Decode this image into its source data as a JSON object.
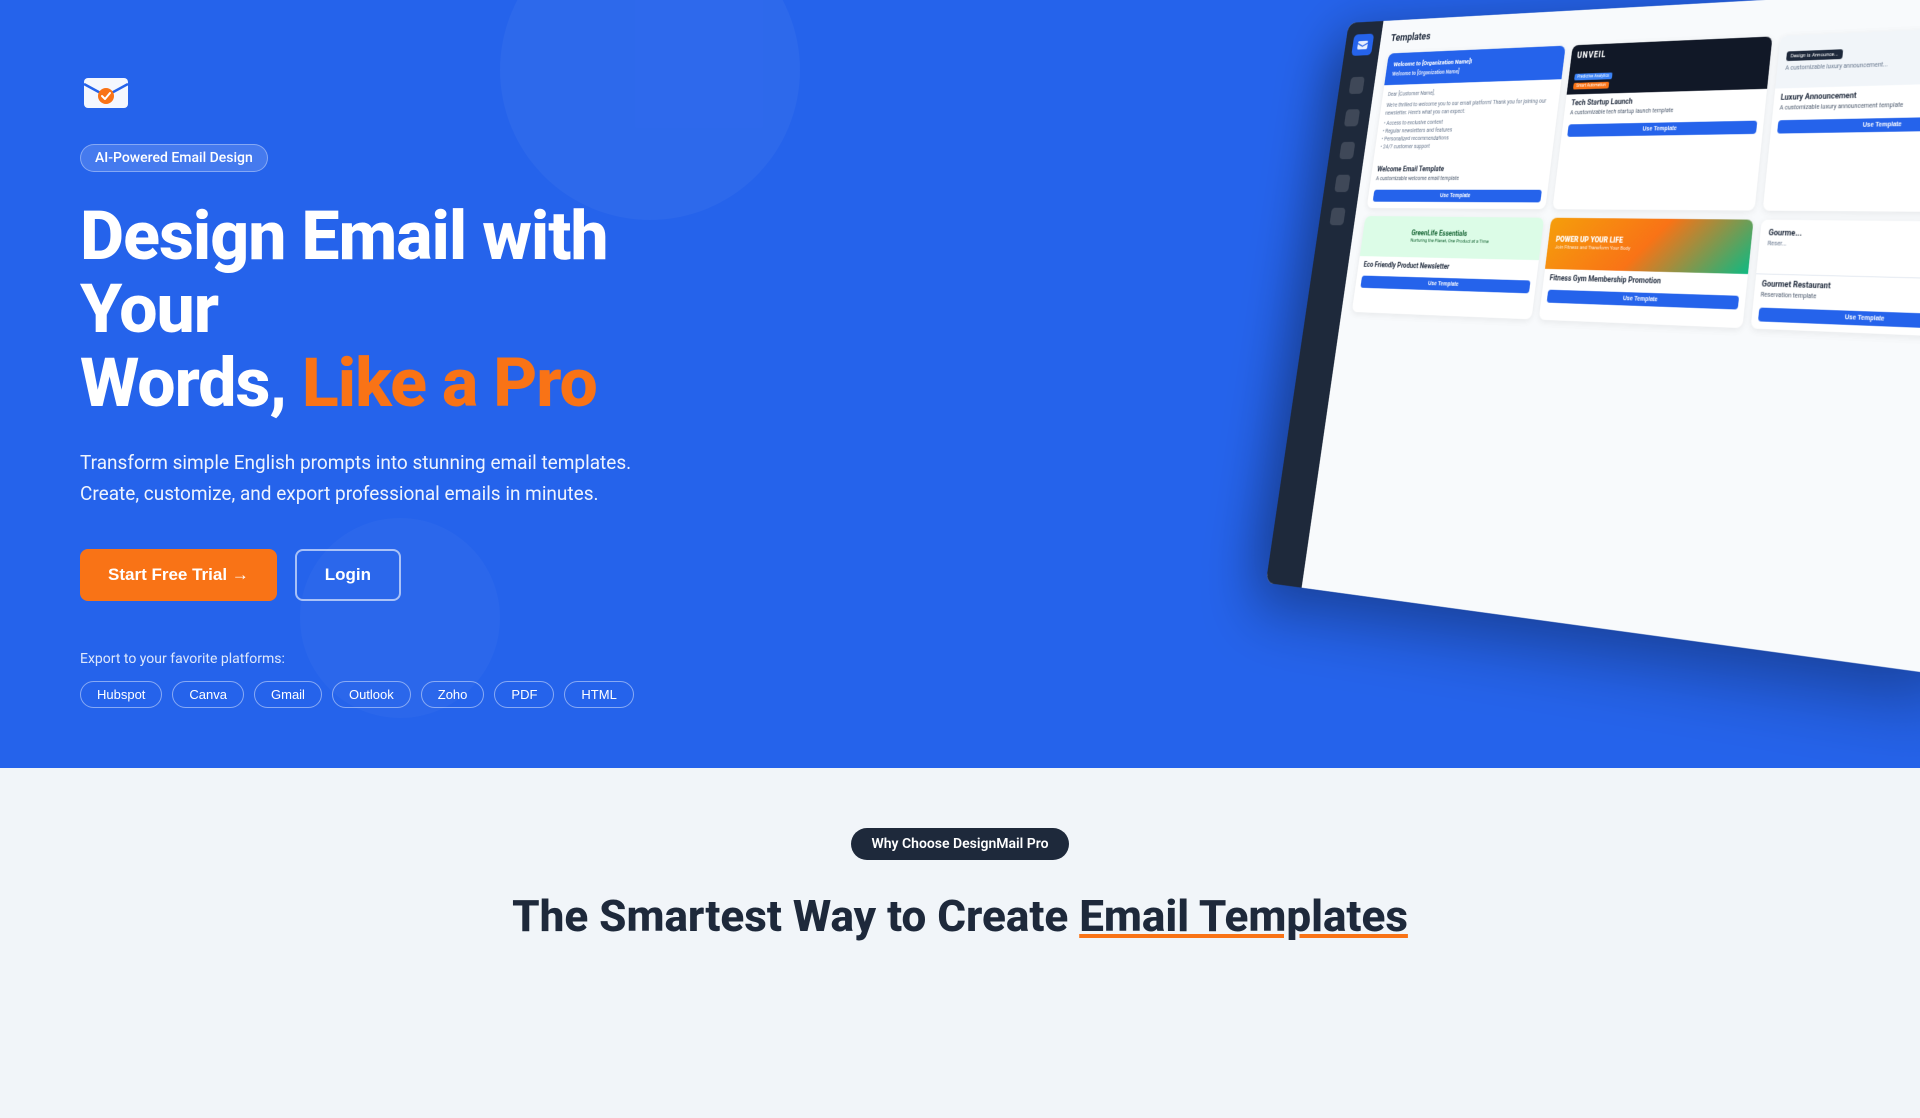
{
  "hero": {
    "badge": "AI-Powered Email Design",
    "headline_line1": "Design Email with Your",
    "headline_line2_plain": "Words, ",
    "headline_line2_highlight": "Like a Pro",
    "subtext": "Transform simple English prompts into stunning email templates. Create, customize, and export professional emails in minutes.",
    "cta_primary": "Start Free Trial →",
    "cta_secondary": "Login",
    "export_label": "Export to your favorite platforms:",
    "platforms": [
      "Hubspot",
      "Canva",
      "Gmail",
      "Outlook",
      "Zoho",
      "PDF",
      "HTML"
    ],
    "bg_color": "#2563eb",
    "accent_color": "#f97316"
  },
  "mock_ui": {
    "header": "Templates",
    "cards": [
      {
        "title": "Welcome Email Template",
        "subtitle": "A customizable welcome email template",
        "type": "welcome"
      },
      {
        "title": "Tech Startup Launch",
        "subtitle": "A customizable tech startup launch template",
        "type": "tech"
      },
      {
        "title": "Luxury Announcement",
        "subtitle": "A customizable luxury announcement template",
        "type": "luxury"
      },
      {
        "title": "Eco Friendly Product Newsletter",
        "subtitle": "GreenLife Essentials",
        "type": "eco"
      },
      {
        "title": "Fitness Gym Membership Promotion",
        "subtitle": "POWER UP YOUR LIFE",
        "type": "fitness"
      },
      {
        "title": "Gourmet Restaurant",
        "subtitle": "Reservation template",
        "type": "restaurant"
      }
    ],
    "use_template_btn": "Use Template"
  },
  "bottom_section": {
    "why_badge": "Why Choose DesignMail Pro",
    "headline_part1": "The Smartest Way to Create Email Templates",
    "headline_underline": "Email Templates"
  }
}
